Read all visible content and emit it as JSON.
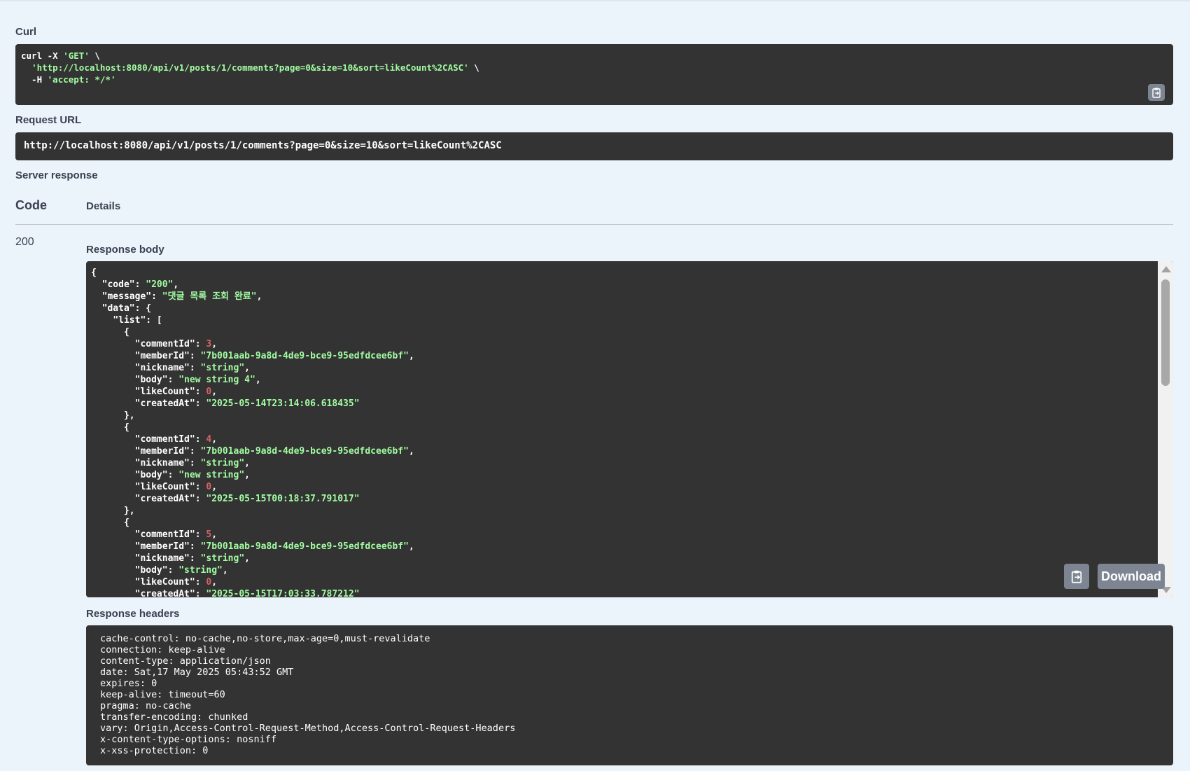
{
  "curl": {
    "label": "Curl",
    "line1": "curl -X ",
    "method": "'GET'",
    "line1_end": " \\",
    "line2_url": "'http://localhost:8080/api/v1/posts/1/comments?page=0&size=10&sort=likeCount%2CASC'",
    "line2_end": " \\",
    "line3_flag": "  -H ",
    "line3_header": "'accept: */*'"
  },
  "request_url": {
    "label": "Request URL",
    "value": "http://localhost:8080/api/v1/posts/1/comments?page=0&size=10&sort=likeCount%2CASC"
  },
  "server_response": {
    "label": "Server response",
    "code_header": "Code",
    "details_header": "Details",
    "code": "200",
    "response_body_label": "Response body",
    "response_headers_label": "Response headers",
    "download_label": "Download"
  },
  "response_body": {
    "code_key": "\"code\"",
    "code_val": "\"200\"",
    "message_key": "\"message\"",
    "message_val": "\"댓글 목록 조회 완료\"",
    "data_key": "\"data\"",
    "list_key": "\"list\"",
    "items": [
      {
        "commentId": "3",
        "memberId": "\"7b001aab-9a8d-4de9-bce9-95edfdcee6bf\"",
        "nickname": "\"string\"",
        "body": "\"new string 4\"",
        "likeCount": "0",
        "createdAt": "\"2025-05-14T23:14:06.618435\""
      },
      {
        "commentId": "4",
        "memberId": "\"7b001aab-9a8d-4de9-bce9-95edfdcee6bf\"",
        "nickname": "\"string\"",
        "body": "\"new string\"",
        "likeCount": "0",
        "createdAt": "\"2025-05-15T00:18:37.791017\""
      },
      {
        "commentId": "5",
        "memberId": "\"7b001aab-9a8d-4de9-bce9-95edfdcee6bf\"",
        "nickname": "\"string\"",
        "body": "\"string\"",
        "likeCount": "0",
        "createdAt": "\"2025-05-15T17:03:33.787212\""
      }
    ]
  },
  "response_headers": [
    "cache-control: no-cache,no-store,max-age=0,must-revalidate",
    "connection: keep-alive",
    "content-type: application/json",
    "date: Sat,17 May 2025 05:43:52 GMT",
    "expires: 0",
    "keep-alive: timeout=60",
    "pragma: no-cache",
    "transfer-encoding: chunked",
    "vary: Origin,Access-Control-Request-Method,Access-Control-Request-Headers",
    "x-content-type-options: nosniff",
    "x-xss-protection: 0"
  ],
  "colors": {
    "background": "#ebf3fb",
    "code_bg": "#333333",
    "string": "#a2fca2",
    "number": "#d36363",
    "button": "#7d8492"
  },
  "icons": {
    "copy": "clipboard-icon"
  }
}
